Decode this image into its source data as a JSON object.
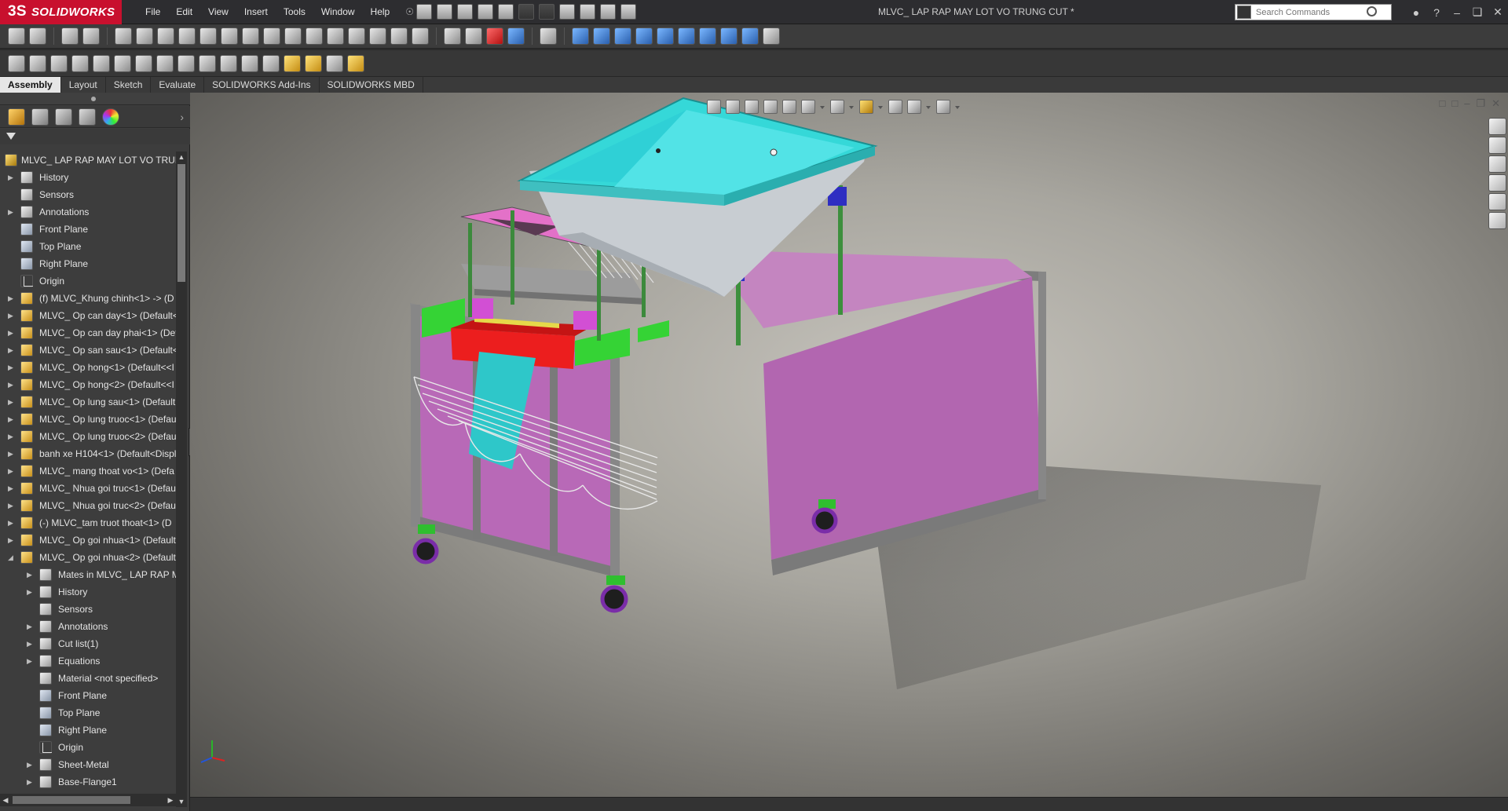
{
  "app": {
    "brand": "SOLIDWORKS",
    "brand_prefix": "3S",
    "doc_title": "MLVC_ LAP RAP MAY LOT VO TRUNG CUT *"
  },
  "menu": [
    "File",
    "Edit",
    "View",
    "Insert",
    "Tools",
    "Window",
    "Help"
  ],
  "search": {
    "placeholder": "Search Commands"
  },
  "command_tabs": [
    "Assembly",
    "Layout",
    "Sketch",
    "Evaluate",
    "SOLIDWORKS Add-Ins",
    "SOLIDWORKS MBD"
  ],
  "active_tab": "Assembly",
  "icons": {
    "window_min": "minimize-icon",
    "window_max": "maximize-icon",
    "window_close": "close-icon",
    "tree_expand": "triangle-right-icon",
    "tree_collapse": "triangle-down-icon"
  },
  "colors": {
    "brand": "#c8102e",
    "hopper": "#36d6d6",
    "panel": "#b062b4",
    "frame": "#8c8c8c"
  },
  "tree": [
    {
      "label": "MLVC_ LAP RAP MAY LOT VO TRUNG",
      "icon": "root-assembly-icon",
      "depth": 0,
      "arrow": ""
    },
    {
      "label": "History",
      "icon": "history-folder-icon",
      "depth": 1,
      "arrow": "r"
    },
    {
      "label": "Sensors",
      "icon": "sensors-folder-icon",
      "depth": 1,
      "arrow": ""
    },
    {
      "label": "Annotations",
      "icon": "annotations-folder-icon",
      "depth": 1,
      "arrow": "r"
    },
    {
      "label": "Front Plane",
      "icon": "plane-icon",
      "depth": 1,
      "arrow": ""
    },
    {
      "label": "Top Plane",
      "icon": "plane-icon",
      "depth": 1,
      "arrow": ""
    },
    {
      "label": "Right Plane",
      "icon": "plane-icon",
      "depth": 1,
      "arrow": ""
    },
    {
      "label": "Origin",
      "icon": "origin-icon",
      "depth": 1,
      "arrow": ""
    },
    {
      "label": "(f) MLVC_Khung chinh<1> -> (D",
      "icon": "part-icon",
      "depth": 1,
      "arrow": "r"
    },
    {
      "label": "MLVC_ Op can day<1> (Default<",
      "icon": "part-icon",
      "depth": 1,
      "arrow": "r"
    },
    {
      "label": "MLVC_ Op can day phai<1> (Def",
      "icon": "part-icon",
      "depth": 1,
      "arrow": "r"
    },
    {
      "label": "MLVC_ Op san sau<1> (Default<",
      "icon": "part-icon",
      "depth": 1,
      "arrow": "r"
    },
    {
      "label": "MLVC_ Op hong<1> (Default<<I",
      "icon": "part-icon",
      "depth": 1,
      "arrow": "r"
    },
    {
      "label": "MLVC_ Op hong<2> (Default<<I",
      "icon": "part-icon",
      "depth": 1,
      "arrow": "r"
    },
    {
      "label": "MLVC_ Op lung sau<1> (Default",
      "icon": "part-icon",
      "depth": 1,
      "arrow": "r"
    },
    {
      "label": "MLVC_ Op lung truoc<1> (Defau",
      "icon": "part-icon",
      "depth": 1,
      "arrow": "r"
    },
    {
      "label": "MLVC_ Op lung truoc<2> (Defau",
      "icon": "part-icon",
      "depth": 1,
      "arrow": "r"
    },
    {
      "label": "banh xe H104<1> (Default<Displ",
      "icon": "part-icon",
      "depth": 1,
      "arrow": "r"
    },
    {
      "label": "MLVC_ mang thoat vo<1> (Defa",
      "icon": "part-icon",
      "depth": 1,
      "arrow": "r"
    },
    {
      "label": "MLVC_ Nhua goi truc<1> (Defau",
      "icon": "part-icon",
      "depth": 1,
      "arrow": "r"
    },
    {
      "label": "MLVC_ Nhua goi truc<2> (Defau",
      "icon": "part-icon",
      "depth": 1,
      "arrow": "r"
    },
    {
      "label": "(-) MLVC_tam truot thoat<1> (D",
      "icon": "part-icon",
      "depth": 1,
      "arrow": "r"
    },
    {
      "label": "MLVC_ Op goi nhua<1> (Default",
      "icon": "part-icon",
      "depth": 1,
      "arrow": "r"
    },
    {
      "label": "MLVC_ Op goi nhua<2> (Default",
      "icon": "part-icon",
      "depth": 1,
      "arrow": "d"
    },
    {
      "label": "Mates in MLVC_ LAP RAP MA",
      "icon": "mates-folder-icon",
      "depth": 2,
      "arrow": "r"
    },
    {
      "label": "History",
      "icon": "history-folder-icon",
      "depth": 2,
      "arrow": "r"
    },
    {
      "label": "Sensors",
      "icon": "sensors-folder-icon",
      "depth": 2,
      "arrow": ""
    },
    {
      "label": "Annotations",
      "icon": "annotations-folder-icon",
      "depth": 2,
      "arrow": "r"
    },
    {
      "label": "Cut list(1)",
      "icon": "cutlist-folder-icon",
      "depth": 2,
      "arrow": "r"
    },
    {
      "label": "Equations",
      "icon": "equations-folder-icon",
      "depth": 2,
      "arrow": "r"
    },
    {
      "label": "Material <not specified>",
      "icon": "material-icon",
      "depth": 2,
      "arrow": ""
    },
    {
      "label": "Front Plane",
      "icon": "plane-icon",
      "depth": 2,
      "arrow": ""
    },
    {
      "label": "Top Plane",
      "icon": "plane-icon",
      "depth": 2,
      "arrow": ""
    },
    {
      "label": "Right Plane",
      "icon": "plane-icon",
      "depth": 2,
      "arrow": ""
    },
    {
      "label": "Origin",
      "icon": "origin-icon",
      "depth": 2,
      "arrow": ""
    },
    {
      "label": "Sheet-Metal",
      "icon": "sheet-metal-icon",
      "depth": 2,
      "arrow": "r"
    },
    {
      "label": "Base-Flange1",
      "icon": "base-flange-icon",
      "depth": 2,
      "arrow": "r"
    }
  ]
}
